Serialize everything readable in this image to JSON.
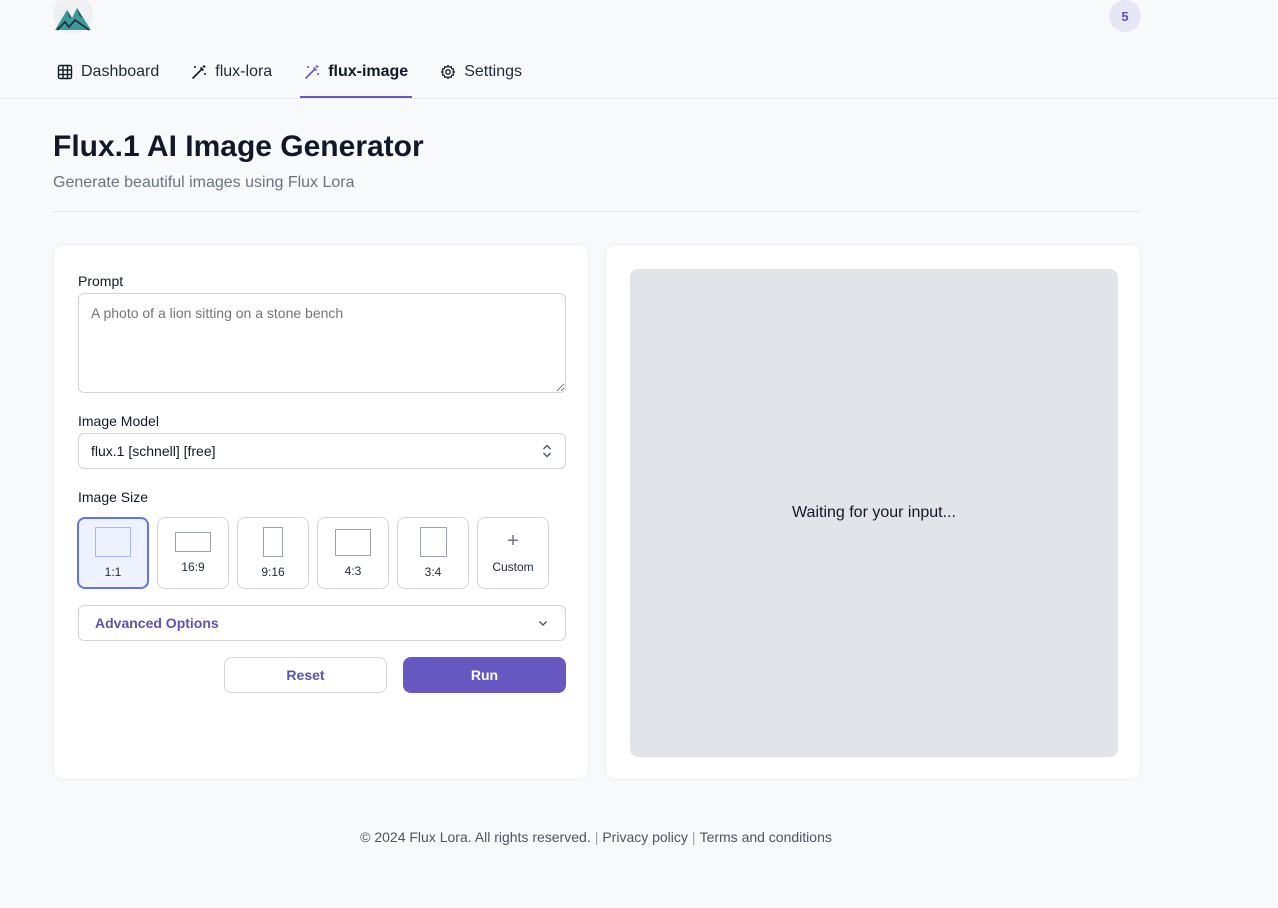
{
  "header": {
    "credits": "5",
    "nav": [
      {
        "label": "Dashboard",
        "icon": "grid-icon"
      },
      {
        "label": "flux-lora",
        "icon": "magic-wand-icon"
      },
      {
        "label": "flux-image",
        "icon": "magic-wand-icon",
        "active": true
      },
      {
        "label": "Settings",
        "icon": "gear-icon"
      }
    ]
  },
  "page": {
    "title": "Flux.1 AI Image Generator",
    "subtitle": "Generate beautiful images using Flux Lora"
  },
  "form": {
    "prompt_label": "Prompt",
    "prompt_placeholder": "A photo of a lion sitting on a stone bench",
    "model_label": "Image Model",
    "model_value": "flux.1 [schnell] [free]",
    "size_label": "Image Size",
    "sizes": [
      {
        "label": "1:1",
        "selected": true
      },
      {
        "label": "16:9"
      },
      {
        "label": "9:16"
      },
      {
        "label": "4:3"
      },
      {
        "label": "3:4"
      },
      {
        "label": "Custom"
      }
    ],
    "advanced_label": "Advanced Options",
    "reset_label": "Reset",
    "run_label": "Run"
  },
  "output": {
    "waiting_text": "Waiting for your input..."
  },
  "footer": {
    "copyright": "© 2024 Flux Lora. All rights reserved.",
    "separator": "|",
    "privacy": "Privacy policy",
    "terms": "Terms and conditions"
  },
  "colors": {
    "accent": "#6658c0",
    "selected_border": "#6176e6",
    "placeholder_bg": "#e3e4e9"
  }
}
